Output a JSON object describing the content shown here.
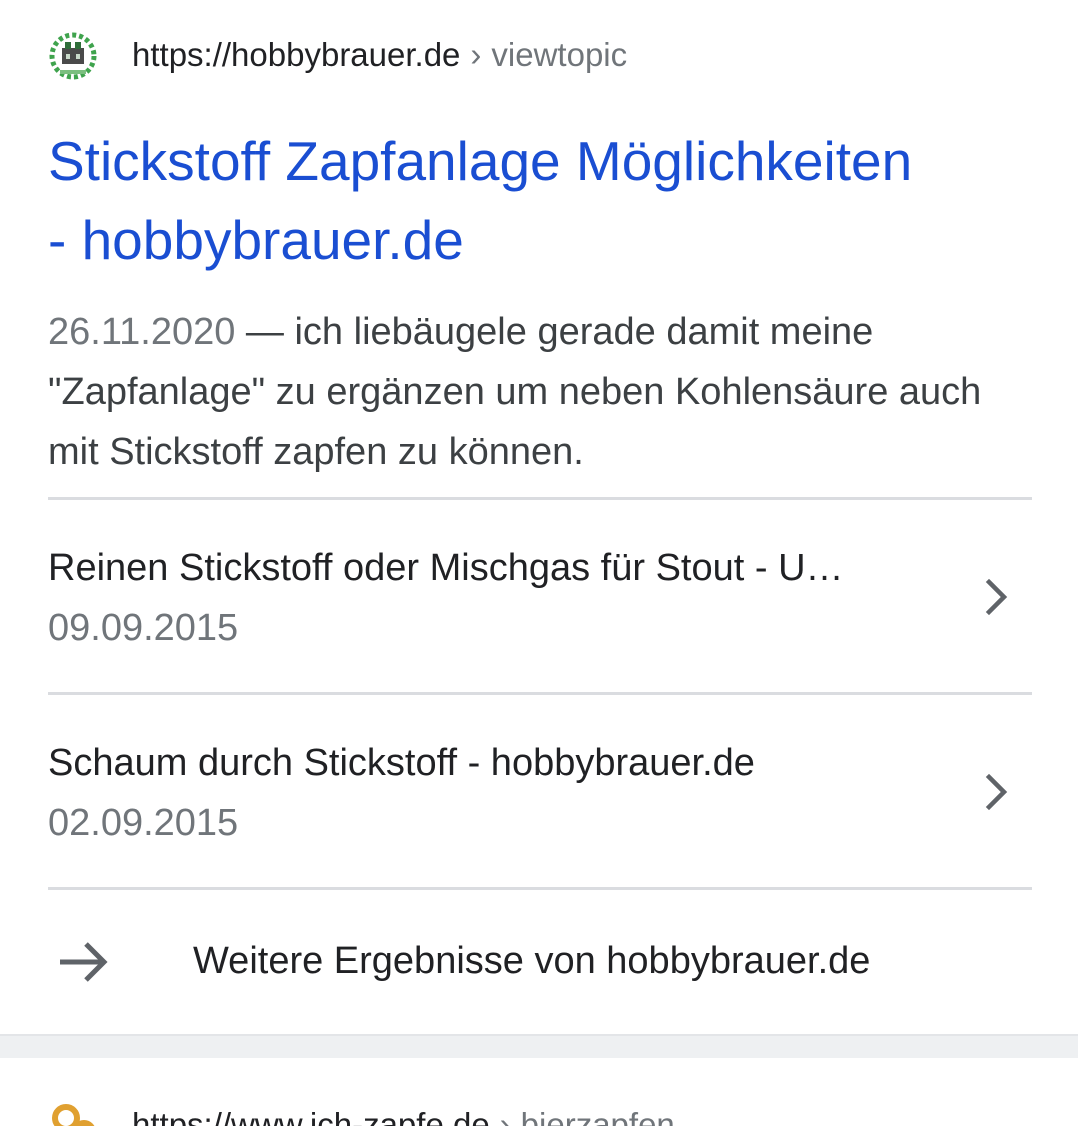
{
  "result": {
    "site_url": "https://hobbybrauer.de",
    "breadcrumb_sep": "›",
    "path": "viewtopic",
    "favicon": "hobbybrauer-logo-icon",
    "title_line1": "Stickstoff Zapfanlage Möglichkeiten",
    "title_line2": "- hobbybrauer.de",
    "snippet_date": "26.11.2020",
    "snippet_text": " — ich liebäugele gerade damit meine \"Zapfanlage\" zu ergänzen um neben Kohlensäure auch mit Stickstoff zapfen zu können.",
    "sublinks": [
      {
        "title": "Reinen Stickstoff oder Mischgas für Stout - U…",
        "date": "09.09.2015",
        "icon": "chevron-right-icon"
      },
      {
        "title": "Schaum durch Stickstoff - hobbybrauer.de",
        "date": "02.09.2015",
        "icon": "chevron-right-icon"
      }
    ],
    "more_results_label": "Weitere Ergebnisse von hobbybrauer.de",
    "more_results_icon": "arrow-right-icon"
  },
  "next_result": {
    "site_url": "https://www.ich-zapfe.de",
    "breadcrumb_sep": "›",
    "path": "bierzapfen",
    "favicon": "ich-zapfe-logo-icon"
  },
  "colors": {
    "title_link": "#1a4ed2",
    "text_primary": "#202124",
    "text_secondary": "#70757a",
    "divider": "#dadce0"
  }
}
